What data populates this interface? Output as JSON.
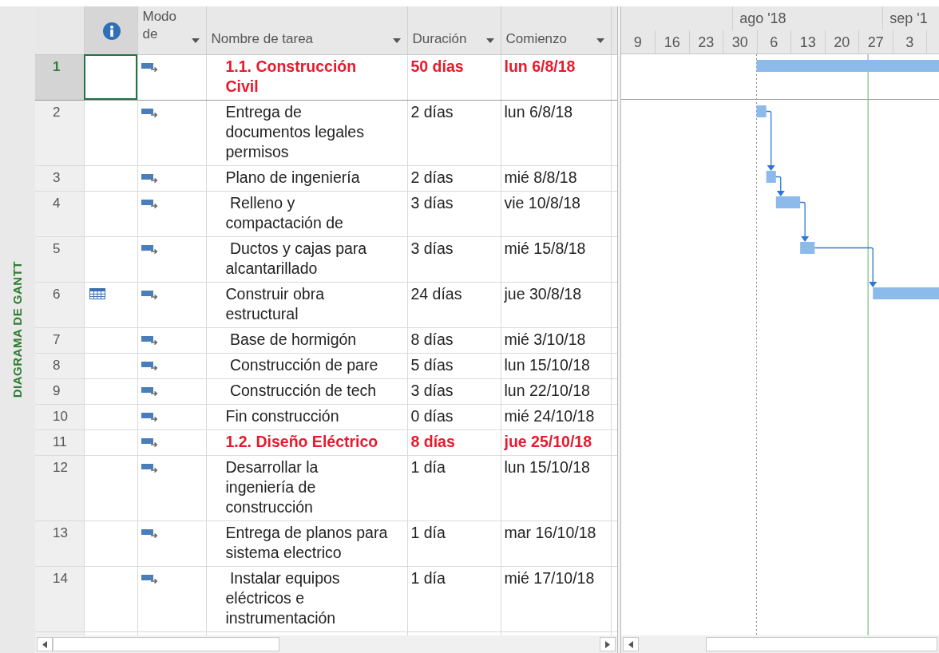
{
  "view_label": "DIAGRAMA DE GANTT",
  "columns": [
    {
      "kind": "info"
    },
    {
      "kind": "mode",
      "label": "Modo de"
    },
    {
      "kind": "name",
      "label": "Nombre de tarea"
    },
    {
      "kind": "duration",
      "label": "Duración"
    },
    {
      "kind": "start",
      "label": "Comienzo"
    }
  ],
  "tasks": [
    {
      "id": "1",
      "kind": "summary",
      "name": "1.1. Construcción\nCivil",
      "duration": "50 días",
      "start": "lun 6/8/18",
      "selected": true,
      "calendar_indicator": false,
      "link_to_next": false
    },
    {
      "id": "2",
      "kind": "task",
      "name": "Entrega de\ndocumentos legales\npermisos",
      "duration": "2 días",
      "start": "lun 6/8/18",
      "selected": false,
      "calendar_indicator": false,
      "link_to_next": true
    },
    {
      "id": "3",
      "kind": "task",
      "name": "Plano de ingeniería",
      "duration": "2 días",
      "start": "mié 8/8/18",
      "selected": false,
      "calendar_indicator": false,
      "link_to_next": true
    },
    {
      "id": "4",
      "kind": "task",
      "name": " Relleno y\ncompactación de",
      "duration": "3 días",
      "start": "vie 10/8/18",
      "selected": false,
      "calendar_indicator": false,
      "link_to_next": true
    },
    {
      "id": "5",
      "kind": "task",
      "name": " Ductos y cajas para\nalcantarillado",
      "duration": "3 días",
      "start": "mié 15/8/18",
      "selected": false,
      "calendar_indicator": false,
      "link_to_next": true
    },
    {
      "id": "6",
      "kind": "task",
      "name": "Construir obra\nestructural",
      "duration": "24 días",
      "start": "jue 30/8/18",
      "selected": false,
      "calendar_indicator": true,
      "link_to_next": false
    },
    {
      "id": "7",
      "kind": "task",
      "name": " Base de hormigón",
      "duration": "8 días",
      "start": "mié 3/10/18",
      "selected": false,
      "calendar_indicator": false,
      "link_to_next": false
    },
    {
      "id": "8",
      "kind": "task",
      "name": " Construcción de pare",
      "duration": "5 días",
      "start": "lun 15/10/18",
      "selected": false,
      "calendar_indicator": false,
      "link_to_next": false
    },
    {
      "id": "9",
      "kind": "task",
      "name": " Construcción de tech",
      "duration": "3 días",
      "start": "lun 22/10/18",
      "selected": false,
      "calendar_indicator": false,
      "link_to_next": false
    },
    {
      "id": "10",
      "kind": "task",
      "name": "Fin construcción",
      "duration": "0 días",
      "start": "mié 24/10/18",
      "selected": false,
      "calendar_indicator": false,
      "link_to_next": false
    },
    {
      "id": "11",
      "kind": "summary",
      "name": "1.2. Diseño Eléctrico",
      "duration": "8 días",
      "start": "jue 25/10/18",
      "selected": false,
      "calendar_indicator": false,
      "link_to_next": false
    },
    {
      "id": "12",
      "kind": "task",
      "name": "Desarrollar la\ningeniería de\nconstrucción",
      "duration": "1 día",
      "start": "lun 15/10/18",
      "selected": false,
      "calendar_indicator": false,
      "link_to_next": false
    },
    {
      "id": "13",
      "kind": "task",
      "name": "Entrega de planos para\nsistema electrico",
      "duration": "1 día",
      "start": "mar 16/10/18",
      "selected": false,
      "calendar_indicator": false,
      "link_to_next": false
    },
    {
      "id": "14",
      "kind": "task",
      "name": " Instalar equipos\neléctricos e\ninstrumentación",
      "duration": "1 día",
      "start": "mié 17/10/18",
      "selected": false,
      "calendar_indicator": false,
      "link_to_next": false
    }
  ],
  "timescale": {
    "months": [
      {
        "label": "ago '18"
      },
      {
        "label": "sep '1"
      }
    ],
    "weeks": [
      "9",
      "16",
      "23",
      "30",
      "6",
      "13",
      "20",
      "27",
      "3"
    ]
  }
}
